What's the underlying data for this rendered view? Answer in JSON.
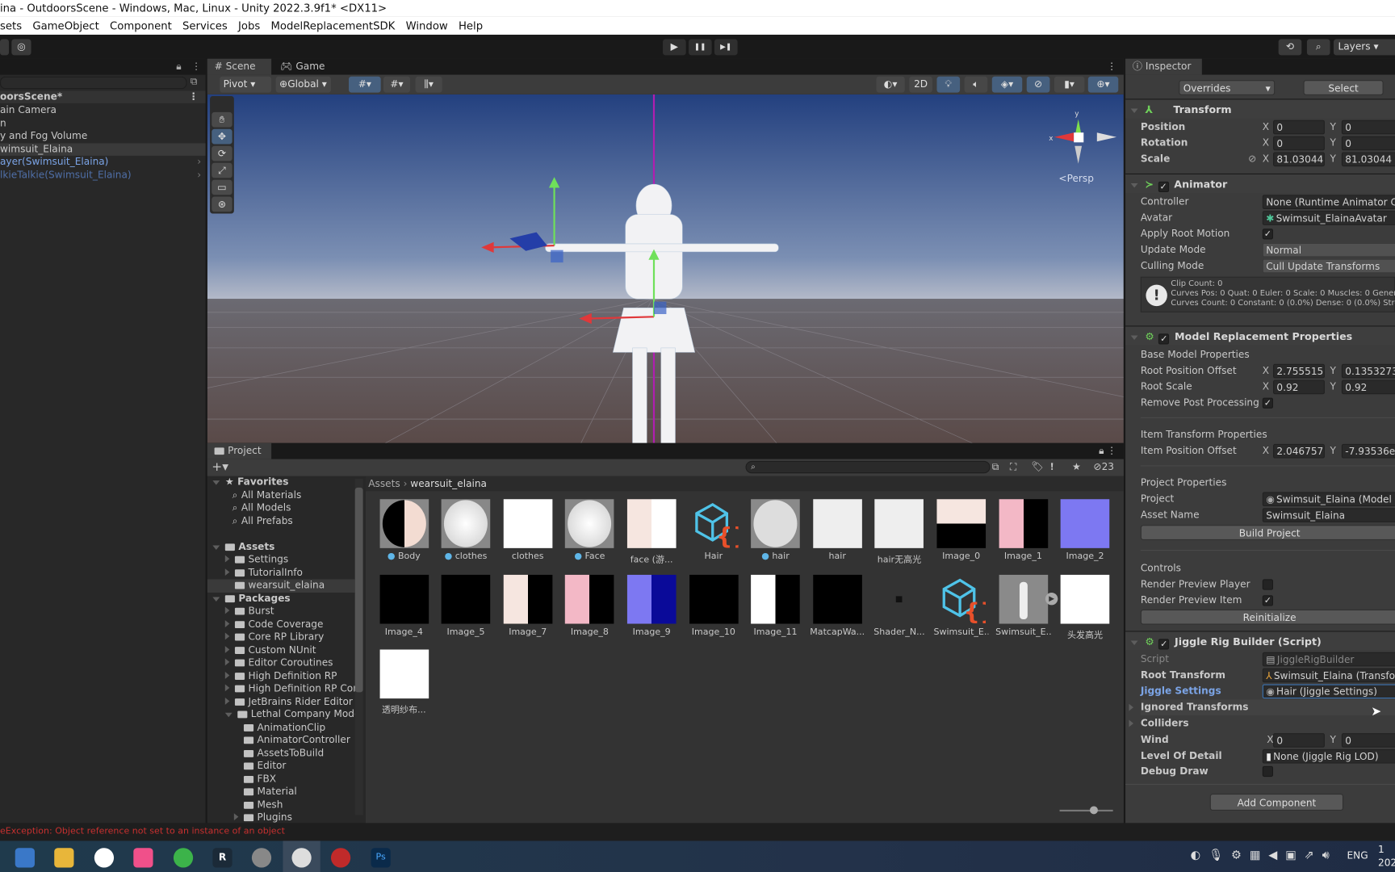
{
  "window": {
    "title": "ina - OutdoorsScene - Windows, Mac, Linux - Unity 2022.3.9f1* <DX11>"
  },
  "menu": [
    "sets",
    "GameObject",
    "Component",
    "Services",
    "Jobs",
    "ModelReplacementSDK",
    "Window",
    "Help"
  ],
  "toolbar": {
    "layers": "Layers",
    "play": "▶",
    "pause": "❚❚",
    "step": "▶❚"
  },
  "hierarchy": {
    "scene": "oorsScene*",
    "items": [
      {
        "label": "ain Camera",
        "color": "#c8c8c8"
      },
      {
        "label": "n",
        "color": "#c8c8c8"
      },
      {
        "label": "y and Fog Volume",
        "color": "#c8c8c8"
      },
      {
        "label": "wimsuit_Elaina",
        "color": "#c8c8c8",
        "selected": true
      },
      {
        "label": "ayer(Swimsuit_Elaina)",
        "color": "#7ba4e6"
      },
      {
        "label": "lkieTalkie(Swimsuit_Elaina)",
        "color": "#4f6fa8"
      }
    ]
  },
  "scene": {
    "tabs": [
      {
        "label": "Scene",
        "icon": "hash-icon"
      },
      {
        "label": "Game",
        "icon": "gamepad-icon"
      }
    ],
    "pivot": "Pivot",
    "global": "Global",
    "mode_2d": "2D",
    "persp": "Persp"
  },
  "project": {
    "tab": "Project",
    "hidden_count": "23",
    "breadcrumb": [
      "Assets",
      "wearsuit_elaina"
    ],
    "favorites": {
      "label": "Favorites",
      "items": [
        "All Materials",
        "All Models",
        "All Prefabs"
      ]
    },
    "assets": {
      "label": "Assets",
      "items": [
        "Settings",
        "TutorialInfo",
        "wearsuit_elaina"
      ]
    },
    "packages": {
      "label": "Packages",
      "items": [
        "Burst",
        "Code Coverage",
        "Core RP Library",
        "Custom NUnit",
        "Editor Coroutines",
        "High Definition RP",
        "High Definition RP Conf",
        "JetBrains Rider Editor",
        "Lethal Company Model"
      ]
    },
    "lethal_children": [
      "AnimationClip",
      "AnimatorController",
      "AssetsToBuild",
      "Editor",
      "FBX",
      "Material",
      "Mesh",
      "Plugins"
    ],
    "grid": [
      {
        "label": "Body",
        "kind": "material"
      },
      {
        "label": "clothes",
        "kind": "material"
      },
      {
        "label": "clothes",
        "kind": "texture"
      },
      {
        "label": "Face",
        "kind": "material"
      },
      {
        "label": "face (游...",
        "kind": "texture"
      },
      {
        "label": "Hair",
        "kind": "script"
      },
      {
        "label": "hair",
        "kind": "material"
      },
      {
        "label": "hair",
        "kind": "texture"
      },
      {
        "label": "hair无高光",
        "kind": "texture"
      },
      {
        "label": "Image_0",
        "kind": "texture"
      },
      {
        "label": "Image_1",
        "kind": "texture"
      },
      {
        "label": "Image_2",
        "kind": "texture"
      },
      {
        "label": "Image_4",
        "kind": "texture"
      },
      {
        "label": "Image_5",
        "kind": "texture"
      },
      {
        "label": "Image_7",
        "kind": "texture"
      },
      {
        "label": "Image_8",
        "kind": "texture"
      },
      {
        "label": "Image_9",
        "kind": "texture"
      },
      {
        "label": "Image_10",
        "kind": "texture"
      },
      {
        "label": "Image_11",
        "kind": "texture"
      },
      {
        "label": "MatcapWa...",
        "kind": "texture"
      },
      {
        "label": "Shader_N...",
        "kind": "shader"
      },
      {
        "label": "Swimsuit_E...",
        "kind": "script"
      },
      {
        "label": "Swimsuit_E...",
        "kind": "model"
      },
      {
        "label": "头发高光",
        "kind": "texture"
      },
      {
        "label": "透明纱布...",
        "kind": "texture"
      }
    ]
  },
  "inspector": {
    "tab": "Inspector",
    "overrides": "Overrides",
    "select": "Select",
    "transform": {
      "title": "Transform",
      "position": {
        "label": "Position",
        "x": "0",
        "y": "0"
      },
      "rotation": {
        "label": "Rotation",
        "x": "0",
        "y": "0"
      },
      "scale": {
        "label": "Scale",
        "x": "81.03044",
        "y": "81.03044"
      }
    },
    "animator": {
      "title": "Animator",
      "controller": {
        "label": "Controller",
        "value": "None (Runtime Animator Con"
      },
      "avatar": {
        "label": "Avatar",
        "value": "Swimsuit_ElainaAvatar"
      },
      "apply_root_motion": {
        "label": "Apply Root Motion",
        "checked": true
      },
      "update_mode": {
        "label": "Update Mode",
        "value": "Normal"
      },
      "culling_mode": {
        "label": "Culling Mode",
        "value": "Cull Update Transforms"
      },
      "info": [
        "Clip Count: 0",
        "Curves Pos: 0 Quat: 0 Euler: 0 Scale: 0 Muscles: 0 Generic",
        "Curves Count: 0 Constant: 0 (0.0%) Dense: 0 (0.0%) Strea"
      ]
    },
    "model_replacement": {
      "title": "Model Replacement Properties",
      "base": "Base Model Properties",
      "root_position_offset": {
        "label": "Root Position Offset",
        "x": "2.755515e",
        "y": "0.1353273"
      },
      "root_scale": {
        "label": "Root Scale",
        "x": "0.92",
        "y": "0.92"
      },
      "remove_post": {
        "label": "Remove Post Processing o",
        "checked": true
      },
      "item_transform": "Item Transform Properties",
      "item_position_offset": {
        "label": "Item Position Offset",
        "x": "2.046757e",
        "y": "-7.93536e"
      },
      "project_props": "Project Properties",
      "project": {
        "label": "Project",
        "value": "Swimsuit_Elaina (Model Re"
      },
      "asset_name": {
        "label": "Asset Name",
        "value": "Swimsuit_Elaina"
      },
      "build": "Build Project",
      "controls": "Controls",
      "render_player": {
        "label": "Render Preview Player",
        "checked": false
      },
      "render_item": {
        "label": "Render Preview Item",
        "checked": true
      },
      "reinit": "Reinitialize"
    },
    "jiggle": {
      "title": "Jiggle Rig Builder (Script)",
      "script": {
        "label": "Script",
        "value": "JiggleRigBuilder"
      },
      "root_transform": {
        "label": "Root Transform",
        "value": "Swimsuit_Elaina (Transfo"
      },
      "jiggle_settings": {
        "label": "Jiggle Settings",
        "value": "Hair (Jiggle Settings)"
      },
      "ignored": "Ignored Transforms",
      "colliders": "Colliders",
      "wind": {
        "label": "Wind",
        "x": "0",
        "y": "0"
      },
      "lod": {
        "label": "Level Of Detail",
        "value": "None (Jiggle Rig LOD)"
      },
      "debug": {
        "label": "Debug Draw",
        "checked": false
      }
    },
    "add_component": "Add Component"
  },
  "status": {
    "error": "eException: Object reference not set to an instance of an object",
    "color": "#d33a3a"
  },
  "taskbar": {
    "lang": "ENG",
    "clock_top": "1",
    "clock_bottom": "202"
  },
  "colors": {
    "accent": "#3a72b0",
    "sky": "#2d4a86",
    "ground": "#4a4548"
  }
}
